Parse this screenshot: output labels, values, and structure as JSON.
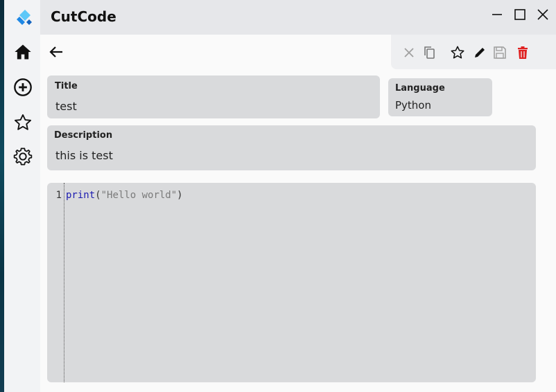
{
  "app": {
    "title": "CutCode"
  },
  "colors": {
    "accent": "#2ea3f2",
    "delete": "#e02020",
    "disabled": "#a0a0a0",
    "keyword": "#1c1cb0",
    "string": "#7a7a7a"
  },
  "sidebar": {
    "items": [
      {
        "name": "home",
        "icon": "home-icon"
      },
      {
        "name": "add",
        "icon": "add-circle-icon"
      },
      {
        "name": "favorites",
        "icon": "star-outline-icon"
      },
      {
        "name": "settings",
        "icon": "gear-icon"
      }
    ]
  },
  "window_controls": [
    "minimize-icon",
    "maximize-icon",
    "close-icon"
  ],
  "toolbar": {
    "buttons": [
      {
        "name": "cancel",
        "icon": "close-icon",
        "enabled": false
      },
      {
        "name": "copy",
        "icon": "copy-icon",
        "enabled": true
      },
      {
        "name": "favorite",
        "icon": "star-outline-icon",
        "enabled": true
      },
      {
        "name": "edit",
        "icon": "pencil-icon",
        "enabled": true
      },
      {
        "name": "save",
        "icon": "save-icon",
        "enabled": false
      },
      {
        "name": "delete",
        "icon": "trash-icon",
        "enabled": true
      }
    ]
  },
  "form": {
    "title_label": "Title",
    "title_value": "test",
    "language_label": "Language",
    "language_value": "Python",
    "description_label": "Description",
    "description_value": "this is test"
  },
  "editor": {
    "lines": [
      {
        "number": "1",
        "tokens": [
          {
            "type": "kw",
            "text": "print"
          },
          {
            "type": "punc",
            "text": "("
          },
          {
            "type": "str",
            "text": "\"Hello world\""
          },
          {
            "type": "punc",
            "text": ")"
          }
        ]
      }
    ]
  }
}
